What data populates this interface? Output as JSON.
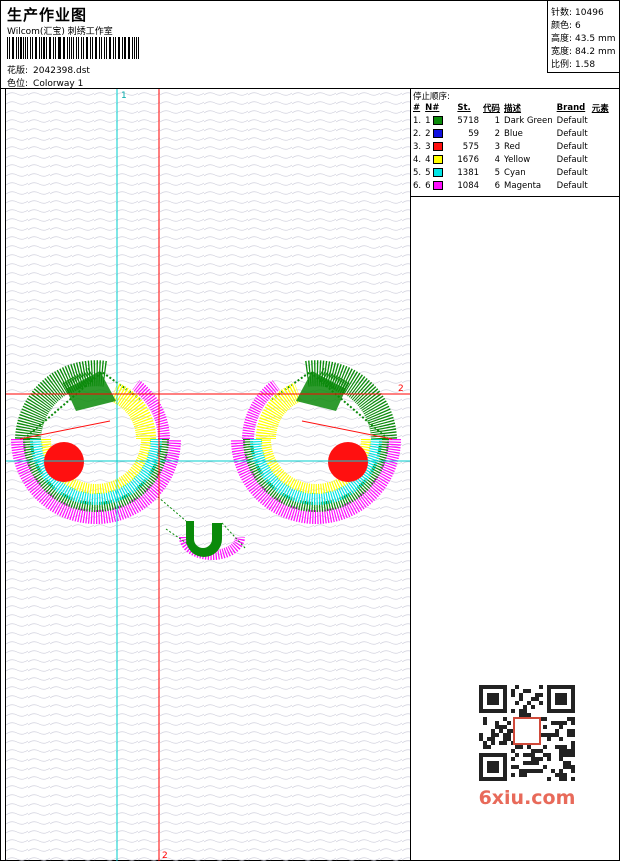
{
  "header": {
    "title": "生产作业图",
    "company": "Wilcom(汇宝) 刺绣工作室",
    "design_label": "花版:",
    "design_value": "2042398.dst",
    "colorway_label": "色位:",
    "colorway_value": "Colorway 1"
  },
  "stats": [
    {
      "label": "针数:",
      "value": "10496"
    },
    {
      "label": "颜色:",
      "value": "6"
    },
    {
      "label": "高度:",
      "value": "43.5 mm"
    },
    {
      "label": "宽度:",
      "value": "84.2 mm"
    },
    {
      "label": "比例:",
      "value": "1.58"
    }
  ],
  "stop_sequence": {
    "caption": "停止顺序:",
    "headers": [
      "#",
      "N#",
      "St.",
      "代码",
      "描述",
      "Brand",
      "元素"
    ],
    "rows": [
      {
        "index": "1.",
        "n": "1",
        "color": "#0a8a0a",
        "stitches": "5718",
        "code": "1",
        "desc": "Dark Green",
        "brand": "Default"
      },
      {
        "index": "2.",
        "n": "2",
        "color": "#1010e0",
        "stitches": "59",
        "code": "2",
        "desc": "Blue",
        "brand": "Default"
      },
      {
        "index": "3.",
        "n": "3",
        "color": "#ff1010",
        "stitches": "575",
        "code": "3",
        "desc": "Red",
        "brand": "Default"
      },
      {
        "index": "4.",
        "n": "4",
        "color": "#ffff00",
        "stitches": "1676",
        "code": "4",
        "desc": "Yellow",
        "brand": "Default"
      },
      {
        "index": "5.",
        "n": "5",
        "color": "#00e5e5",
        "stitches": "1381",
        "code": "5",
        "desc": "Cyan",
        "brand": "Default"
      },
      {
        "index": "6.",
        "n": "6",
        "color": "#ff10ff",
        "stitches": "1084",
        "code": "6",
        "desc": "Magenta",
        "brand": "Default"
      }
    ]
  },
  "guides": {
    "cyan_vertical": "1",
    "red_vertical": "2",
    "red_horizontal": "2"
  },
  "watermark": {
    "brand": "6xiu.com",
    "seal_color": "#d04a3a"
  }
}
